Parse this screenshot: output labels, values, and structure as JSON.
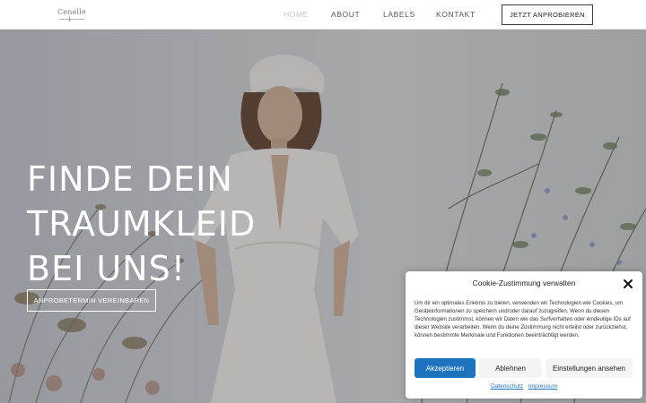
{
  "header": {
    "logo_text": "Cenelle",
    "nav": [
      {
        "label": "HOME",
        "active": true
      },
      {
        "label": "ABOUT",
        "active": false
      },
      {
        "label": "LABELS",
        "active": false
      },
      {
        "label": "KONTAKT",
        "active": false
      }
    ],
    "cta_label": "JETZT ANPROBIEREN"
  },
  "hero": {
    "title_lines": [
      "FINDE DEIN",
      "TRAUMKLEID",
      "BEI UNS!"
    ],
    "button_label": "ANPROBETERMIN VEREINBAREN"
  },
  "cookie": {
    "title": "Cookie-Zustimmung verwalten",
    "text": "Um dir ein optimales Erlebnis zu bieten, verwenden wir Technologien wie Cookies, um Geräteinformationen zu speichern und/oder darauf zuzugreifen. Wenn du diesen Technologien zustimmst, können wir Daten wie das Surfverhalten oder eindeutige IDs auf dieser Website verarbeiten. Wenn du deine Zustimmung nicht erteilst oder zurückziehst, können bestimmte Merkmale und Funktionen beeinträchtigt werden.",
    "accept_label": "Akzeptieren",
    "deny_label": "Ablehnen",
    "settings_label": "Einstellungen ansehen",
    "privacy_link": "Datenschutz",
    "imprint_link": "Impressum"
  },
  "colors": {
    "accent": "#1e73be",
    "nav_text": "#555555",
    "nav_active": "#c4c4c4",
    "hero_text": "#ffffff"
  },
  "icons": {
    "close": "close-icon"
  }
}
